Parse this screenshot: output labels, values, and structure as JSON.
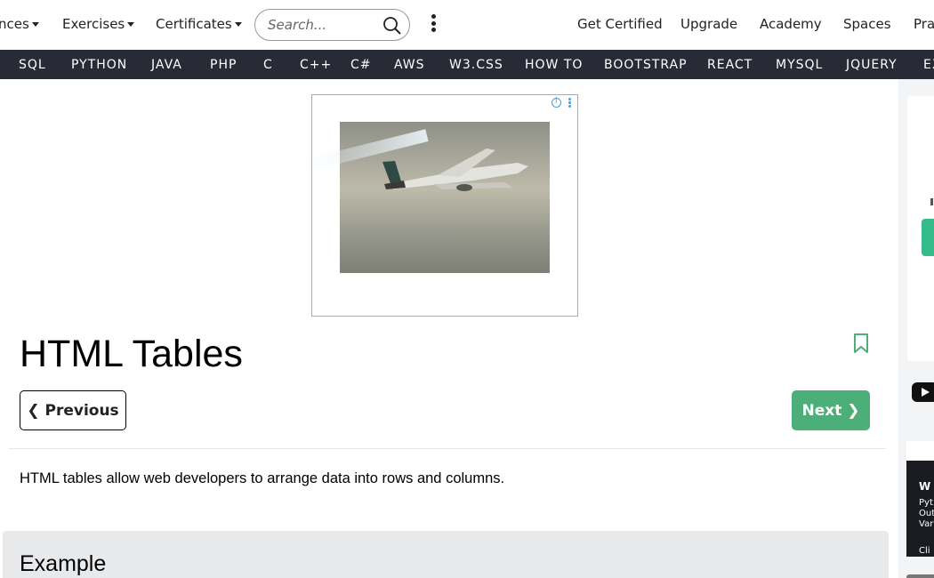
{
  "topbar": {
    "references_label": "nces",
    "exercises_label": "Exercises",
    "certificates_label": "Certificates",
    "search_placeholder": "Search...",
    "get_certified": "Get Certified",
    "upgrade": "Upgrade",
    "academy": "Academy",
    "spaces": "Spaces",
    "practice": "Prac"
  },
  "nav": {
    "items": [
      "SQL",
      "PYTHON",
      "JAVA",
      "PHP",
      "C",
      "C++",
      "C#",
      "AWS",
      "W3.CSS",
      "HOW TO",
      "BOOTSTRAP",
      "REACT",
      "MYSQL",
      "JQUERY",
      "EX"
    ]
  },
  "sidebar": {
    "lines": [
      "W",
      "Pyt",
      "Out",
      "Vari",
      "Cli"
    ]
  },
  "page": {
    "title": "HTML Tables",
    "previous_label": "Previous",
    "next_label": "Next",
    "intro": "HTML tables allow web developers to arrange data into rows and columns.",
    "example_title": "Example"
  },
  "colors": {
    "nav_bg": "#282a35",
    "accent_green": "#4caf7a",
    "example_bg": "#e7e9eb"
  }
}
